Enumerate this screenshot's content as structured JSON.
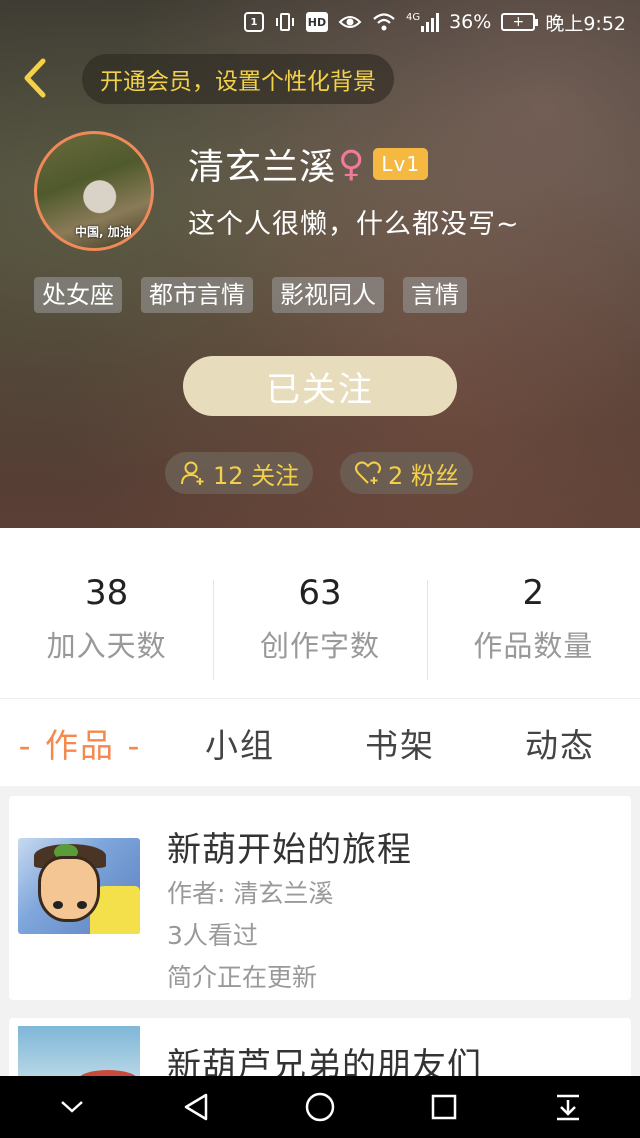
{
  "status_bar": {
    "battery": "36%",
    "time": "晚上9:52",
    "network": "4G",
    "hd": "HD"
  },
  "top_bar": {
    "vip_prompt": "开通会员，设置个性化背景"
  },
  "profile": {
    "username": "清玄兰溪",
    "gender_symbol": "♀",
    "level": "Lv1",
    "bio": "这个人很懒，什么都没写~",
    "avatar_caption": "中国, 加油",
    "tags": [
      "处女座",
      "都市言情",
      "影视同人",
      "言情"
    ],
    "follow_button": "已关注",
    "following_chip": "12 关注",
    "fans_chip": "2 粉丝"
  },
  "stats": [
    {
      "value": "38",
      "label": "加入天数"
    },
    {
      "value": "63",
      "label": "创作字数"
    },
    {
      "value": "2",
      "label": "作品数量"
    }
  ],
  "tabs": [
    {
      "label": "- 作品 -",
      "active": true
    },
    {
      "label": "小组",
      "active": false
    },
    {
      "label": "书架",
      "active": false
    },
    {
      "label": "动态",
      "active": false
    }
  ],
  "works": [
    {
      "title": "新葫开始的旅程",
      "author": "作者: 清玄兰溪",
      "views": "3人看过",
      "intro": "简介正在更新"
    },
    {
      "title": "新葫芦兄弟的朋友们"
    }
  ],
  "colors": {
    "accent": "#f4884d",
    "gold": "#f2d04c",
    "level_badge": "#f5b840",
    "follow_button": "#e7dcbb"
  }
}
